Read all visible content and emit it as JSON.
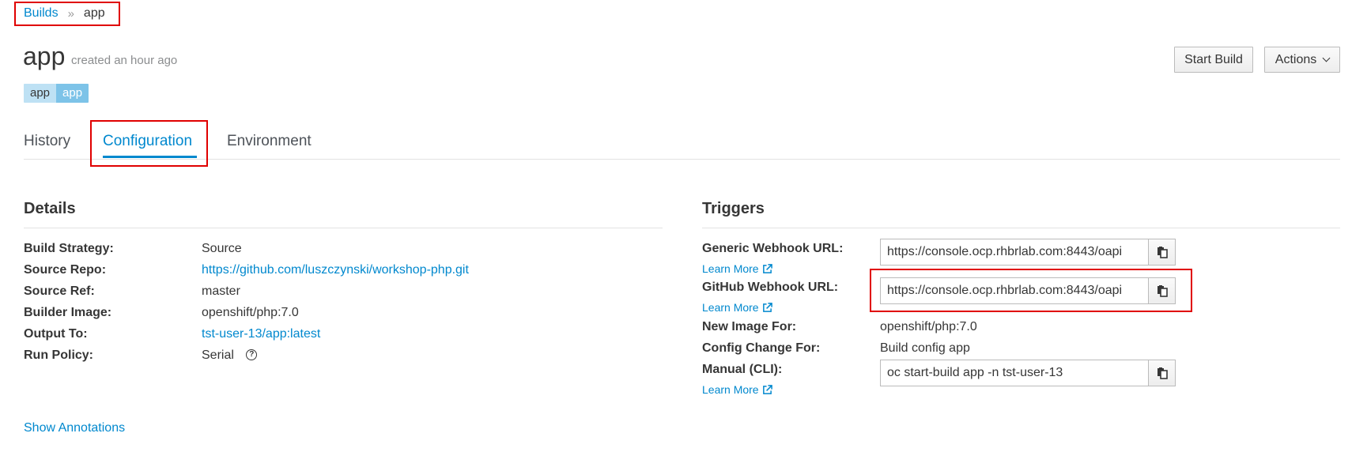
{
  "breadcrumb": {
    "parent": "Builds",
    "separator": "»",
    "current": "app"
  },
  "header": {
    "title": "app",
    "created": "created an hour ago",
    "start_build_label": "Start Build",
    "actions_label": "Actions"
  },
  "labels": [
    {
      "key": "app",
      "value": "app"
    }
  ],
  "tabs": [
    {
      "label": "History"
    },
    {
      "label": "Configuration",
      "active": true
    },
    {
      "label": "Environment"
    }
  ],
  "details": {
    "title": "Details",
    "rows": [
      {
        "key": "Build Strategy:",
        "value": "Source"
      },
      {
        "key": "Source Repo:",
        "value": "https://github.com/luszczynski/workshop-php.git",
        "link": true
      },
      {
        "key": "Source Ref:",
        "value": "master"
      },
      {
        "key": "Builder Image:",
        "value": "openshift/php:7.0"
      },
      {
        "key": "Output To:",
        "value": "tst-user-13/app:latest",
        "link": true
      },
      {
        "key": "Run Policy:",
        "value": "Serial"
      }
    ]
  },
  "triggers": {
    "title": "Triggers",
    "generic_key": "Generic Webhook URL:",
    "generic_value": "https://console.ocp.rhbrlab.com:8443/oapi",
    "github_key": "GitHub Webhook URL:",
    "github_value": "https://console.ocp.rhbrlab.com:8443/oapi",
    "learn_more": "Learn More",
    "new_image_key": "New Image For:",
    "new_image_value": "openshift/php:7.0",
    "config_change_key": "Config Change For:",
    "config_change_value": "Build config app",
    "manual_key": "Manual (CLI):",
    "manual_value": "oc start-build app -n tst-user-13"
  },
  "show_annotations": "Show Annotations",
  "colors": {
    "link": "#0088ce",
    "highlight": "#e00000",
    "label_key_bg": "#bee1f4",
    "label_value_bg": "#7dc3e8"
  },
  "icons": [
    "chevron-down-icon",
    "help-icon",
    "external-link-icon",
    "copy-icon"
  ]
}
